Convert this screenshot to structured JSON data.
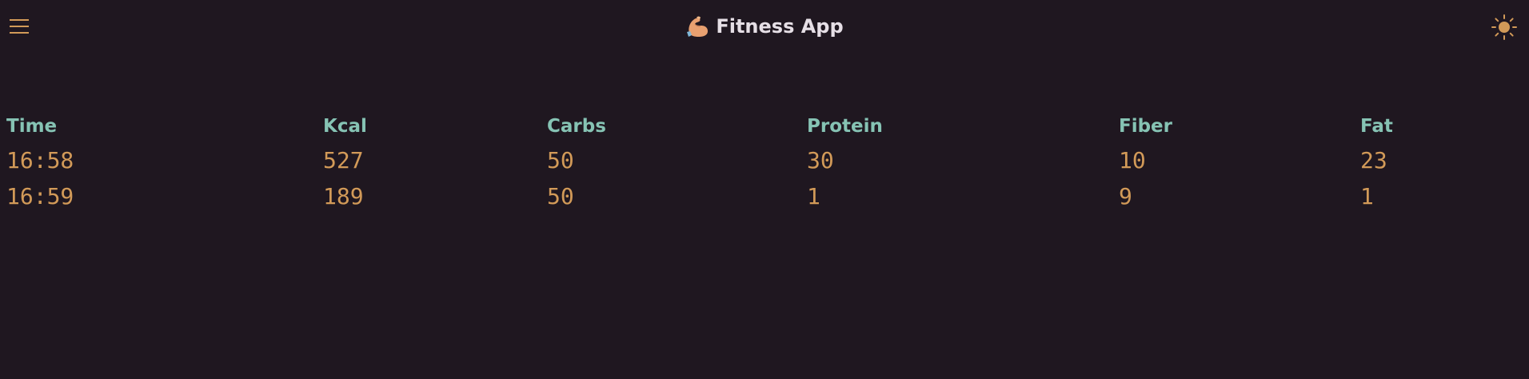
{
  "app": {
    "title": "Fitness App",
    "title_emoji": "flexed-biceps-icon",
    "menu_icon": "hamburger-menu-icon",
    "theme_icon": "sun-icon"
  },
  "table": {
    "headers": [
      "Time",
      "Kcal",
      "Carbs",
      "Protein",
      "Fiber",
      "Fat"
    ],
    "rows": [
      [
        "16:58",
        "527",
        "50",
        "30",
        "10",
        "23"
      ],
      [
        "16:59",
        "189",
        "50",
        "1",
        "9",
        "1"
      ]
    ]
  },
  "colors": {
    "background": "#1f1720",
    "title": "#e6dfe6",
    "header_text": "#86c3b4",
    "value_text": "#d29a58",
    "icon_accent": "#d29a58"
  }
}
